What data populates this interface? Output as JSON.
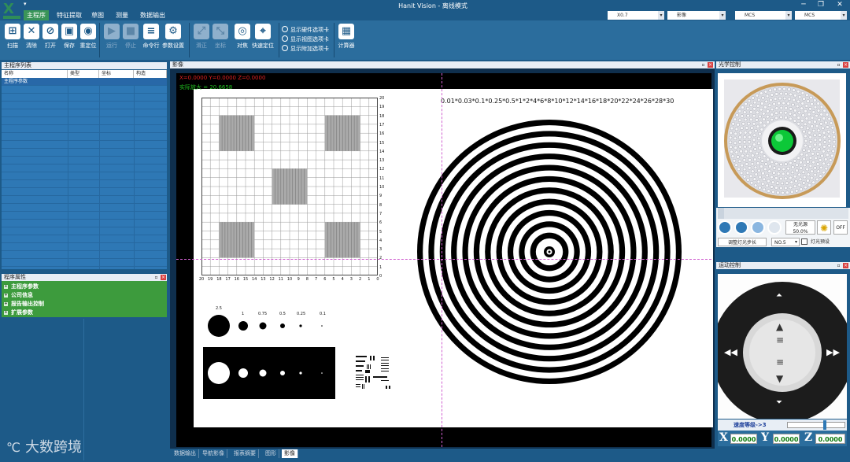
{
  "app": {
    "title": "Hanit Vision - 离线模式"
  },
  "menu": {
    "tabs": [
      "主程序",
      "特征提取",
      "草图",
      "测量",
      "数据输出"
    ],
    "active": 0
  },
  "topright": {
    "zoom": "X0.7",
    "view": "影像",
    "coord1": "MCS",
    "coord2": "MCS"
  },
  "toolbar": {
    "buttons": [
      {
        "label": "扫描",
        "icon": "scan-icon",
        "glyph": "⊞",
        "enabled": true
      },
      {
        "label": "清除",
        "icon": "clear-icon",
        "glyph": "✕",
        "enabled": true
      },
      {
        "label": "打开",
        "icon": "open-icon",
        "glyph": "⊘",
        "enabled": true
      },
      {
        "label": "保存",
        "icon": "save-icon",
        "glyph": "▣",
        "enabled": true
      },
      {
        "label": "重定位",
        "icon": "relocate-icon",
        "glyph": "◉",
        "enabled": true
      },
      {
        "label": "运行",
        "icon": "run-icon",
        "glyph": "▶",
        "enabled": false
      },
      {
        "label": "停止",
        "icon": "stop-icon",
        "glyph": "■",
        "enabled": false
      },
      {
        "label": "命令行",
        "icon": "command-line-icon",
        "glyph": "≡",
        "enabled": true
      },
      {
        "label": "参数设置",
        "icon": "settings-icon",
        "glyph": "⚙",
        "enabled": true
      },
      {
        "label": "滑正",
        "icon": "align-icon",
        "glyph": "⤢",
        "enabled": false
      },
      {
        "label": "坐标",
        "icon": "coordinate-icon",
        "glyph": "⤡",
        "enabled": false
      },
      {
        "label": "对焦",
        "icon": "focus-icon",
        "glyph": "◎",
        "enabled": true
      },
      {
        "label": "快速定位",
        "icon": "quick-locate-icon",
        "glyph": "⌖",
        "enabled": true
      },
      {
        "label": "计算器",
        "icon": "calculator-icon",
        "glyph": "▦",
        "enabled": true
      }
    ],
    "checks": [
      "显示硬件选项卡",
      "显示视图选项卡",
      "显示附加选项卡"
    ]
  },
  "program_list": {
    "title": "主程序列表",
    "columns": [
      "名称",
      "类型",
      "坐标",
      "构造"
    ],
    "rows": [
      [
        "主程序参数",
        "",
        "",
        ""
      ]
    ]
  },
  "program_props": {
    "title": "程序属性",
    "rows": [
      "主程序参数",
      "公司信息",
      "报告输出控制",
      "扩展参数"
    ]
  },
  "image_view": {
    "title": "影像",
    "coords_text": "X=0.0000 Y=0.0000 Z=0.0000",
    "mag_text": "实际放大 = 20.6658",
    "scale_text": "0.01*0.03*0.1*0.25*0.5*1*2*4*6*8*10*12*14*16*18*20*22*24*26*28*30",
    "x_ticks": [
      "20",
      "19",
      "18",
      "17",
      "16",
      "15",
      "14",
      "13",
      "12",
      "11",
      "10",
      "9",
      "8",
      "7",
      "6",
      "5",
      "4",
      "3",
      "2",
      "1",
      "0"
    ],
    "y_ticks": [
      "20",
      "19",
      "18",
      "17",
      "16",
      "15",
      "14",
      "13",
      "12",
      "11",
      "10",
      "9",
      "8",
      "7",
      "6",
      "5",
      "4",
      "3",
      "2",
      "1",
      "0"
    ],
    "dot_labels": [
      "2.5",
      "1",
      "0.75",
      "0.5",
      "0.25",
      "0.1"
    ]
  },
  "bottom_tabs": {
    "labels": [
      "数据输出",
      "导航影像",
      "报表摘要",
      "图形",
      "影像"
    ],
    "active": 4
  },
  "light": {
    "title": "光学控制",
    "no_light": "无光源",
    "percent": "50.0%",
    "adjust": "调整灯光步长",
    "step": "NO.5",
    "preset": "灯光预设",
    "off": "OFF"
  },
  "motion": {
    "title": "运动控制",
    "speed": "速度等级->3",
    "x": "0.0000",
    "y": "0.0000",
    "z": "0.0000"
  },
  "watermark": "大数跨境"
}
